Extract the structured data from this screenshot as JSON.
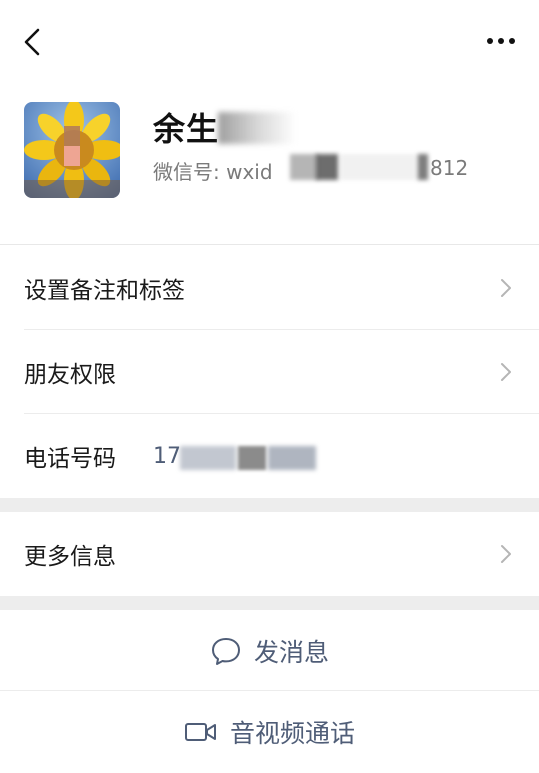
{
  "header": {
    "back_icon": "chevron-left-icon",
    "more_icon": "more-dots-icon"
  },
  "profile": {
    "name_visible": "余生",
    "wechat_id_label": "微信号: wxid",
    "wechat_id_suffix": "812"
  },
  "rows": {
    "remark_tags": "设置备注和标签",
    "friend_permissions": "朋友权限",
    "phone_label": "电话号码",
    "phone_value_visible": "17",
    "more_info": "更多信息"
  },
  "actions": {
    "send_message": "发消息",
    "av_call": "音视频通话"
  },
  "colors": {
    "link_blue": "#4f5d77",
    "separator_gray": "#ededed"
  }
}
